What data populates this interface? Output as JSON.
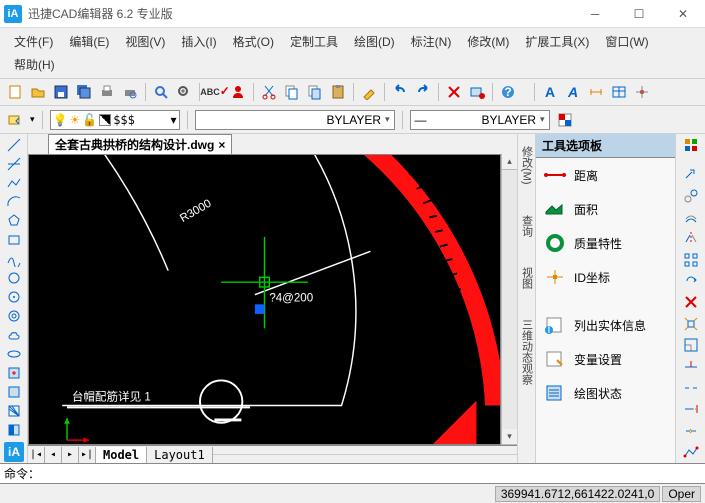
{
  "title": "迅捷CAD编辑器 6.2 专业版",
  "menus": [
    "文件(F)",
    "编辑(E)",
    "视图(V)",
    "插入(I)",
    "格式(O)",
    "定制工具",
    "绘图(D)",
    "标注(N)",
    "修改(M)",
    "扩展工具(X)",
    "窗口(W)",
    "帮助(H)"
  ],
  "prop": {
    "sss": "$$$",
    "bylayer1": "BYLAYER",
    "bylayer2": "BYLAYER"
  },
  "file_tab": {
    "name": "全套古典拱桥的结构设计.dwg",
    "close": "×"
  },
  "drawing": {
    "r3000": "R3000",
    "dim": "?4@200",
    "note": "台帽配筋详见 1"
  },
  "layout": {
    "model": "Model",
    "layout1": "Layout1"
  },
  "side_tabs": [
    "修改(M)",
    "查询",
    "视图",
    "三维动态观察"
  ],
  "palette": {
    "title": "工具选项板",
    "items": [
      "距离",
      "面积",
      "质量特性",
      "ID坐标",
      "列出实体信息",
      "变量设置",
      "绘图状态"
    ]
  },
  "cmd": "命令：",
  "status": {
    "coords": "369941.6712,661422.0241,0",
    "oper": "Oper"
  }
}
